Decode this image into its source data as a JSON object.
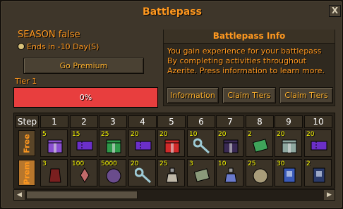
{
  "window": {
    "title": "Battlepass",
    "close_glyph": "X"
  },
  "season": {
    "text": "SEASON false",
    "ends_text": "Ends in -10 Day(S)"
  },
  "premium_button": "Go Premium",
  "tier": {
    "label": "Tier 1",
    "progress_text": "0%",
    "progress_fraction": 0
  },
  "info": {
    "title": "Battlepass Info",
    "lines": [
      "You gain experience for your battlepass",
      "By completing activities throughout",
      "Azerite. Press information to learn more."
    ],
    "buttons": [
      "Information",
      "Claim Tiers",
      "Claim Tiers"
    ]
  },
  "grid": {
    "step_label": "Step",
    "steps": [
      "1",
      "2",
      "3",
      "4",
      "5",
      "6",
      "7",
      "8",
      "9",
      "10"
    ],
    "free_label": "Free",
    "prem_label": "Prem",
    "free": [
      {
        "qty": "5",
        "icon": "mystery-box-icon",
        "color": "#8a4fd1"
      },
      {
        "qty": "15",
        "icon": "purple-ticket-icon",
        "color": "#6b2fc9"
      },
      {
        "qty": "25",
        "icon": "green-gift-icon",
        "color": "#2e9a4a"
      },
      {
        "qty": "20",
        "icon": "purple-ticket-icon",
        "color": "#6b2fc9"
      },
      {
        "qty": "20",
        "icon": "red-gift-icon",
        "color": "#d12a2a"
      },
      {
        "qty": "10",
        "icon": "key-icon",
        "color": "#9ecbd6"
      },
      {
        "qty": "20",
        "icon": "dark-box-icon",
        "color": "#3a2a55"
      },
      {
        "qty": "2",
        "icon": "green-scroll-icon",
        "color": "#3fa35a"
      },
      {
        "qty": "20",
        "icon": "chest-icon",
        "color": "#8fa8a0"
      },
      {
        "qty": "20",
        "icon": "purple-ticket-icon",
        "color": "#6b2fc9"
      }
    ],
    "prem": [
      {
        "qty": "3",
        "icon": "cape-icon",
        "color": "#7a1f1f"
      },
      {
        "qty": "100",
        "icon": "shard-icon",
        "color": "#c06a6a"
      },
      {
        "qty": "5000",
        "icon": "orb-icon",
        "color": "#6a4c8c"
      },
      {
        "qty": "20",
        "icon": "key-icon",
        "color": "#9ecbd6"
      },
      {
        "qty": "25",
        "icon": "potion-icon",
        "color": "#bfb8a8"
      },
      {
        "qty": "3",
        "icon": "map-scroll-icon",
        "color": "#8a9a7a"
      },
      {
        "qty": "10",
        "icon": "vial-icon",
        "color": "#6a7acb"
      },
      {
        "qty": "25",
        "icon": "coin-pouch-icon",
        "color": "#a89c7a"
      },
      {
        "qty": "30",
        "icon": "spellbook-icon",
        "color": "#3a5ab8"
      },
      {
        "qty": "2",
        "icon": "tome-icon",
        "color": "#2a3a6a"
      }
    ]
  },
  "scrollbar": {
    "left_arrow": "◀",
    "right_arrow": "▶"
  }
}
